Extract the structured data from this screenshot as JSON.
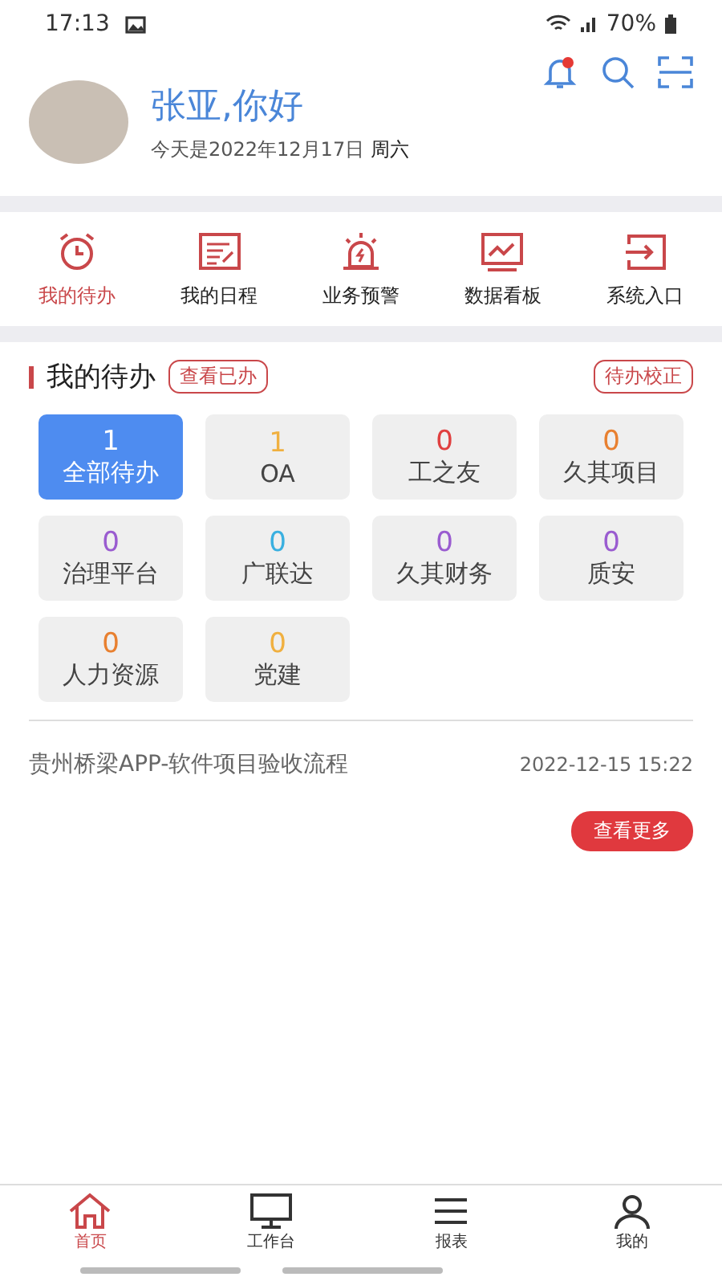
{
  "status_bar": {
    "time": "17:13",
    "battery": "70%"
  },
  "header": {
    "greeting": "张亚,你好",
    "date": "今天是2022年12月17日",
    "weekday": "周六",
    "has_notification": true
  },
  "quick_nav": [
    {
      "label": "我的待办",
      "kind": "clock",
      "selected": true
    },
    {
      "label": "我的日程",
      "kind": "note",
      "selected": false
    },
    {
      "label": "业务预警",
      "kind": "alarm",
      "selected": false
    },
    {
      "label": "数据看板",
      "kind": "monitor",
      "selected": false
    },
    {
      "label": "系统入口",
      "kind": "enter",
      "selected": false
    }
  ],
  "todo": {
    "title": "我的待办",
    "view_done": "查看已办",
    "calibrate": "待办校正",
    "tiles": [
      {
        "count": "1",
        "label": "全部待办",
        "color": "#ffffff",
        "selected": true
      },
      {
        "count": "1",
        "label": "OA",
        "color": "#f0b040",
        "selected": false
      },
      {
        "count": "0",
        "label": "工之友",
        "color": "#e04040",
        "selected": false
      },
      {
        "count": "0",
        "label": "久其项目",
        "color": "#e88030",
        "selected": false
      },
      {
        "count": "0",
        "label": "治理平台",
        "color": "#9a5cd0",
        "selected": false
      },
      {
        "count": "0",
        "label": "广联达",
        "color": "#3ab0e0",
        "selected": false
      },
      {
        "count": "0",
        "label": "久其财务",
        "color": "#9a5cd0",
        "selected": false
      },
      {
        "count": "0",
        "label": "质安",
        "color": "#9a5cd0",
        "selected": false
      },
      {
        "count": "0",
        "label": "人力资源",
        "color": "#e88030",
        "selected": false
      },
      {
        "count": "0",
        "label": "党建",
        "color": "#f0b040",
        "selected": false
      }
    ],
    "items": [
      {
        "title": "贵州桥梁APP-软件项目验收流程",
        "time": "2022-12-15 15:22"
      }
    ],
    "more": "查看更多"
  },
  "tab_bar": [
    {
      "label": "首页",
      "kind": "home",
      "selected": true
    },
    {
      "label": "工作台",
      "kind": "desktop",
      "selected": false
    },
    {
      "label": "报表",
      "kind": "list",
      "selected": false
    },
    {
      "label": "我的",
      "kind": "user",
      "selected": false
    }
  ]
}
